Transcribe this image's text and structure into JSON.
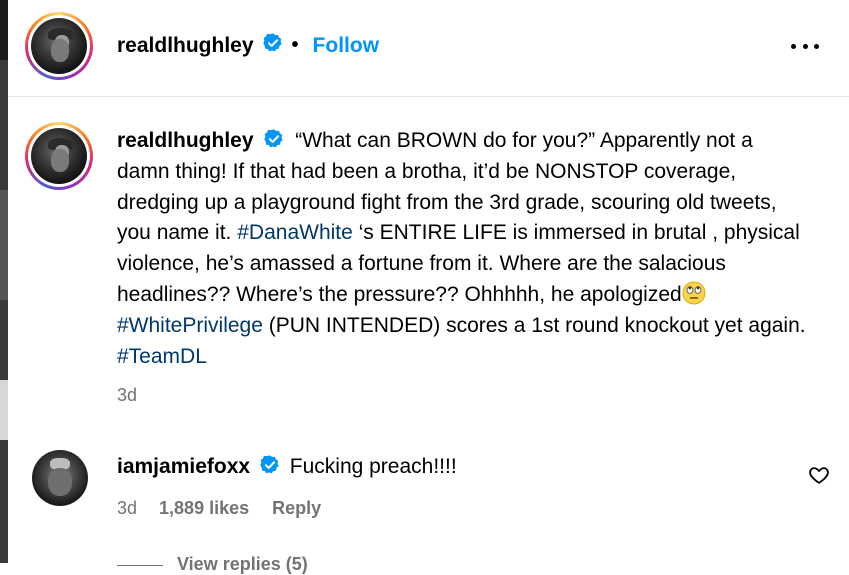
{
  "post": {
    "author": "realdlhughley",
    "separator": "•",
    "follow_label": "Follow"
  },
  "caption": {
    "author": "realdlhughley",
    "seg1": "“What can BROWN do for you?” Apparently not a damn thing! If that had been a brotha, it’d be NONSTOP coverage, dredging up a playground fight from the 3rd grade, scouring old tweets, you name it. ",
    "tag1": "#DanaWhite",
    "seg2": " ‘s ENTIRE LIFE is immersed in brutal , physical violence, he’s amassed a fortune from it. Where are the salacious headlines?? Where’s the pressure?? Ohhhhh, he apologized",
    "tag2": "#WhitePrivilege",
    "seg3": " (PUN INTENDED) scores a 1st round knockout yet again. ",
    "tag3": "#TeamDL",
    "time": "3d"
  },
  "comment": {
    "author": "iamjamiefoxx",
    "text": "Fucking preach!!!!",
    "time": "3d",
    "likes": "1,889 likes",
    "reply_label": "Reply",
    "view_replies": "View replies (5)"
  },
  "icons": {
    "verified": "verified-badge-icon",
    "more": "more-options-icon",
    "heart": "heart-icon",
    "emoji": "eye-roll-emoji"
  },
  "colors": {
    "link": "#0095f6",
    "hashtag": "#00376b",
    "verified": "#0095f6",
    "muted": "#737373"
  }
}
